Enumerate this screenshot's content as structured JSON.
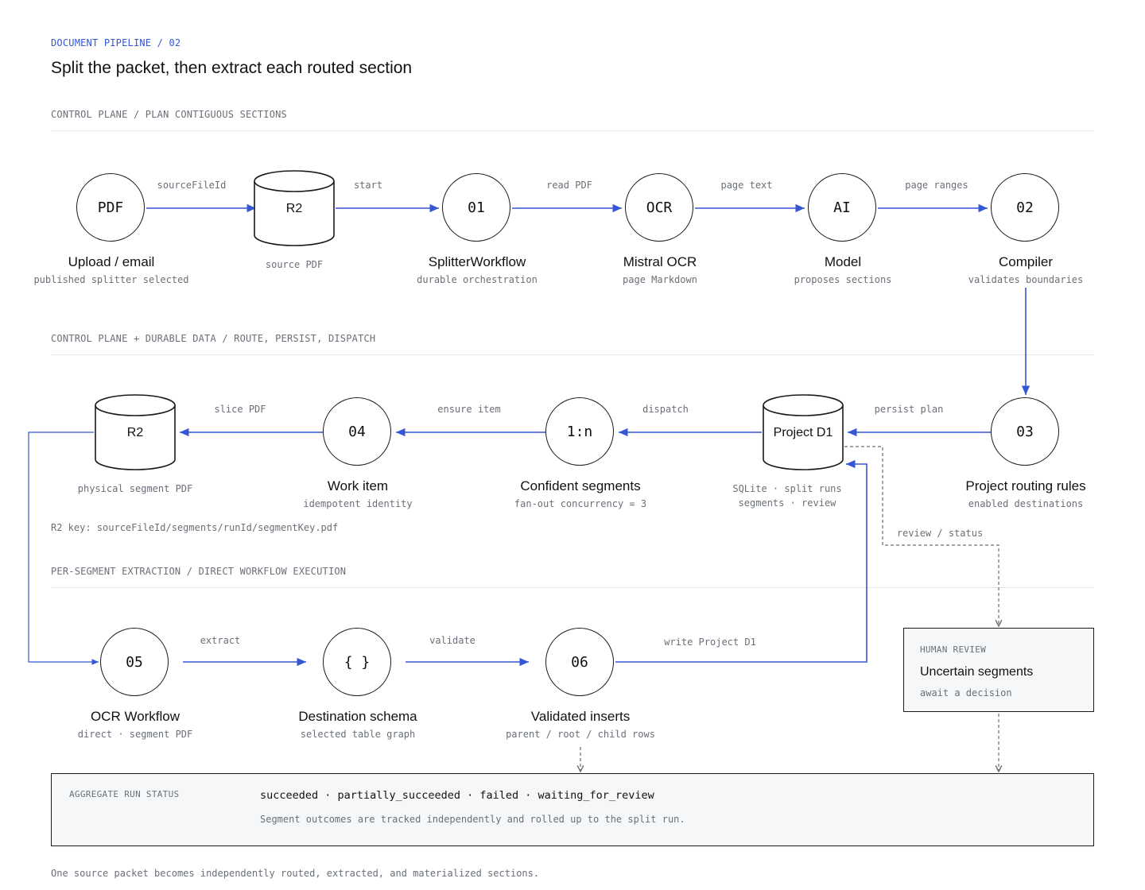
{
  "header": {
    "eyebrow": "DOCUMENT PIPELINE / 02",
    "title": "Split the packet, then extract each routed section"
  },
  "sections": [
    {
      "label": "CONTROL PLANE / PLAN CONTIGUOUS SECTIONS"
    },
    {
      "label": "CONTROL PLANE + DURABLE DATA / ROUTE, PERSIST, DISPATCH"
    },
    {
      "label": "PER-SEGMENT EXTRACTION / DIRECT WORKFLOW EXECUTION"
    }
  ],
  "row1": {
    "pdf": {
      "glyph": "PDF",
      "title": "Upload / email",
      "sub": "published splitter selected"
    },
    "r2": {
      "glyph": "R2",
      "sub": "source PDF"
    },
    "splitter": {
      "glyph": "01",
      "title": "SplitterWorkflow",
      "sub": "durable orchestration"
    },
    "ocr": {
      "glyph": "OCR",
      "title": "Mistral OCR",
      "sub": "page Markdown"
    },
    "model": {
      "glyph": "AI",
      "title": "Model",
      "sub": "proposes sections"
    },
    "compiler": {
      "glyph": "02",
      "title": "Compiler",
      "sub": "validates boundaries"
    },
    "edges": [
      "sourceFileId",
      "start",
      "read PDF",
      "page text",
      "page ranges"
    ]
  },
  "row2": {
    "r2": {
      "glyph": "R2",
      "sub": "physical segment PDF"
    },
    "work": {
      "glyph": "04",
      "title": "Work item",
      "sub": "idempotent identity"
    },
    "segments": {
      "glyph": "1:n",
      "title": "Confident segments",
      "sub": "fan-out concurrency = 3"
    },
    "d1": {
      "glyph": "Project D1",
      "sub1": "SQLite · split runs",
      "sub2": "segments · review"
    },
    "routing": {
      "glyph": "03",
      "title": "Project routing rules",
      "sub": "enabled destinations"
    },
    "edges": [
      "slice PDF",
      "ensure item",
      "dispatch",
      "persist plan"
    ],
    "review_edge": "review / status",
    "r2_key": "R2 key: sourceFileId/segments/runId/segmentKey.pdf"
  },
  "row3": {
    "ocrwf": {
      "glyph": "05",
      "title": "OCR Workflow",
      "sub": "direct · segment PDF"
    },
    "schema": {
      "glyph": "{ }",
      "title": "Destination schema",
      "sub": "selected table graph"
    },
    "validated": {
      "glyph": "06",
      "title": "Validated inserts",
      "sub": "parent / root / child rows"
    },
    "edges": [
      "extract",
      "validate",
      "write Project D1"
    ]
  },
  "human_review": {
    "eyebrow": "HUMAN REVIEW",
    "title": "Uncertain segments",
    "sub": "await a decision"
  },
  "aggregate": {
    "eyebrow": "AGGREGATE RUN STATUS",
    "values": "succeeded · partially_succeeded · failed · waiting_for_review",
    "note": "Segment outcomes are tracked independently and rolled up to the split run."
  },
  "footer": "One source packet becomes independently routed, extracted, and materialized sections.",
  "colors": {
    "accent": "#3557d6",
    "ink": "#1a1a1a",
    "muted": "#6a6f78",
    "panel": "#f6f7f9"
  }
}
